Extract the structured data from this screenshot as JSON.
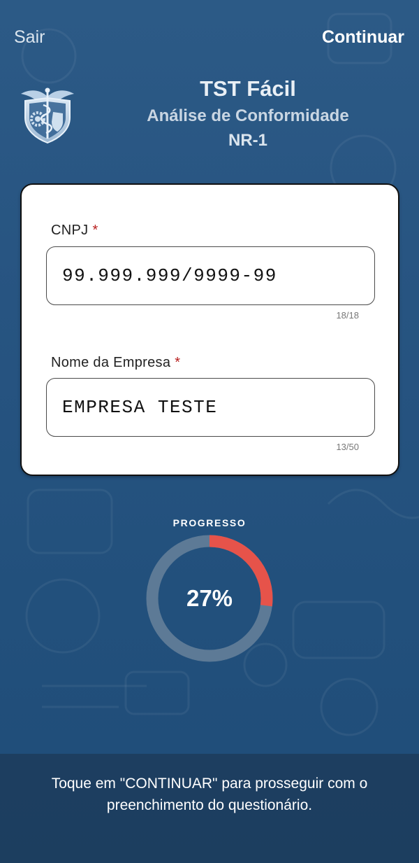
{
  "nav": {
    "exit_label": "Sair",
    "continue_label": "Continuar"
  },
  "header": {
    "title": "TST Fácil",
    "subtitle": "Análise de Conformidade",
    "subtitle2": "NR-1",
    "logo_icon": "caduceus-shield-gear-logo"
  },
  "form": {
    "cnpj": {
      "label": "CNPJ",
      "required_mark": "*",
      "value": "99.999.999/9999-99",
      "counter": "18/18"
    },
    "company": {
      "label": "Nome da Empresa",
      "required_mark": "*",
      "value": "EMPRESA TESTE",
      "counter": "13/50"
    }
  },
  "progress": {
    "label": "PROGRESSO",
    "value_text": "27%",
    "fraction": 0.27,
    "fill_color": "#e6534a",
    "track_color": "#5d7a96"
  },
  "footer": {
    "text": "Toque em \"CONTINUAR\" para prosseguir com o preenchimento do questionário."
  },
  "colors": {
    "background": "#275481",
    "required": "#b8201f"
  }
}
